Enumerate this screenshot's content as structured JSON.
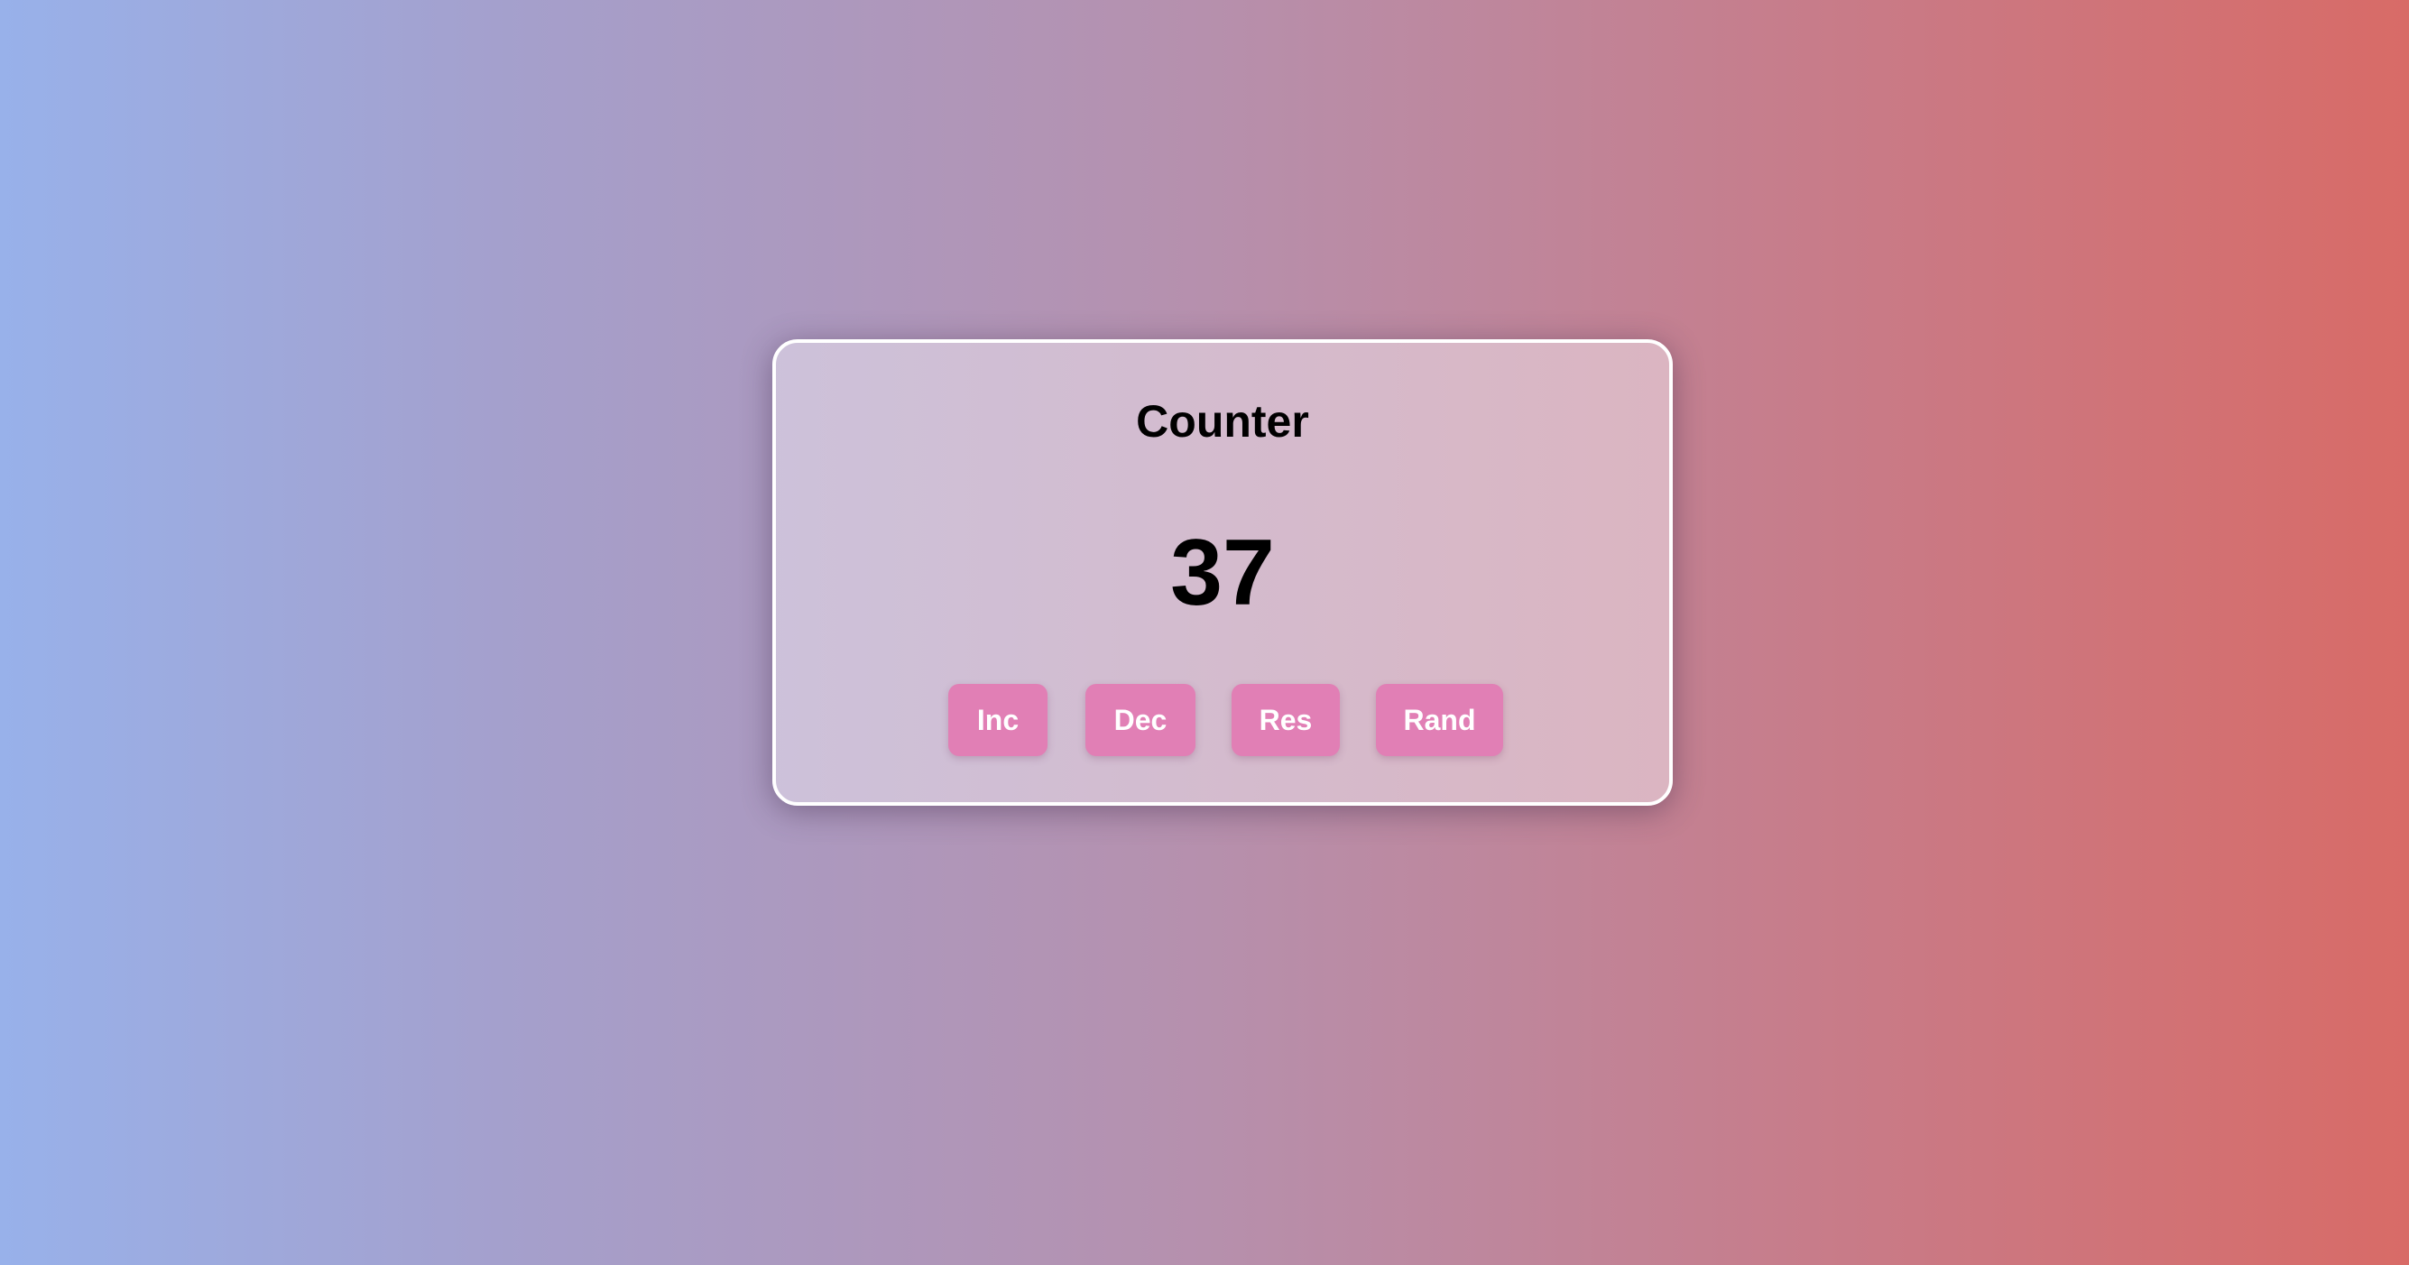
{
  "counter": {
    "title": "Counter",
    "value": "37",
    "buttons": {
      "inc": "Inc",
      "dec": "Dec",
      "res": "Res",
      "rand": "Rand"
    }
  },
  "colors": {
    "gradient_start": "#98b1ea",
    "gradient_end": "#d86b67",
    "button": "#e17fb5",
    "card_border": "#ffffff"
  }
}
